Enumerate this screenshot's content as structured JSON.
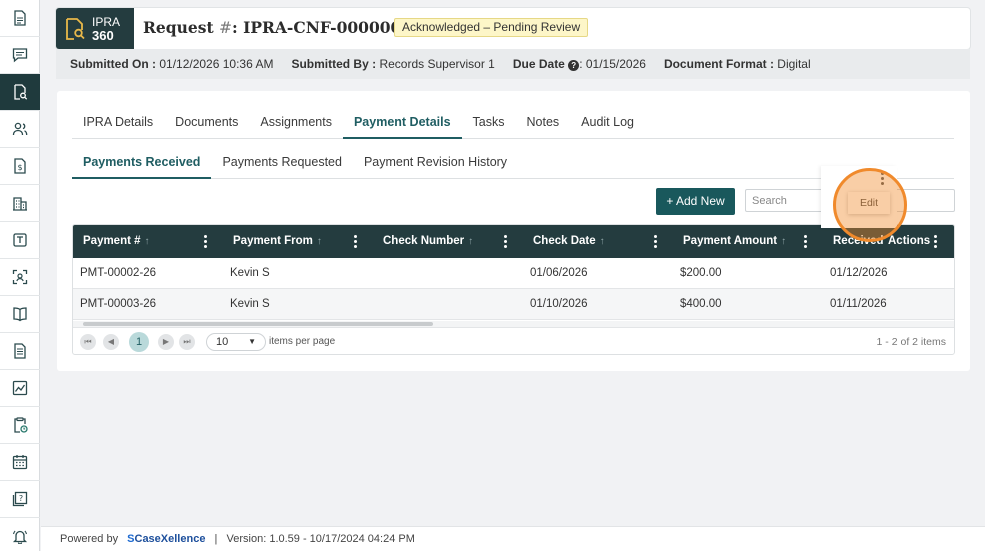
{
  "rail": {
    "items": [
      {
        "icon": "document-icon"
      },
      {
        "icon": "chat-icon"
      },
      {
        "icon": "document-search-icon",
        "active": true
      },
      {
        "icon": "users-icon"
      },
      {
        "icon": "invoice-icon"
      },
      {
        "icon": "building-icon"
      },
      {
        "icon": "template-icon"
      },
      {
        "icon": "scan-user-icon"
      },
      {
        "icon": "book-icon"
      },
      {
        "icon": "report-icon"
      },
      {
        "icon": "chart-icon"
      },
      {
        "icon": "clipboard-clock-icon"
      },
      {
        "icon": "calendar-icon"
      },
      {
        "icon": "help-doc-icon"
      },
      {
        "icon": "bell-icon"
      }
    ]
  },
  "header": {
    "logo_line1": "IPRA",
    "logo_line2": "360",
    "title_prefix": "Request ",
    "title_hash": "#",
    "title_id": ": IPRA-CNF-0000009-26",
    "status": "Acknowledged – Pending Review"
  },
  "meta": {
    "submitted_on_label": "Submitted On :",
    "submitted_on": "01/12/2026 10:36 AM",
    "submitted_by_label": "Submitted By :",
    "submitted_by": "Records Supervisor 1",
    "due_date_label": "Due Date",
    "due_date": ": 01/15/2026",
    "format_label": "Document Format :",
    "format": "Digital"
  },
  "tabs": [
    "IPRA Details",
    "Documents",
    "Assignments",
    "Payment Details",
    "Tasks",
    "Notes",
    "Audit Log"
  ],
  "active_tab": "Payment Details",
  "subtabs": [
    "Payments Received",
    "Payments Requested",
    "Payment Revision History"
  ],
  "toolbar": {
    "add_label": "+ Add New",
    "search_placeholder": "Search"
  },
  "grid": {
    "columns": [
      "Payment #",
      "Payment From",
      "Check Number",
      "Check Date",
      "Payment Amount",
      "Received",
      "Actions"
    ],
    "rows": [
      {
        "payment_no": "PMT-00002-26",
        "from": "Kevin S",
        "check_no": "",
        "check_date": "01/06/2026",
        "amount": "$200.00",
        "received": "01/12/2026"
      },
      {
        "payment_no": "PMT-00003-26",
        "from": "Kevin S",
        "check_no": "",
        "check_date": "01/10/2026",
        "amount": "$400.00",
        "received": "01/11/2026"
      }
    ],
    "action_menu": "Edit",
    "pager": {
      "page": "1",
      "page_size": "10",
      "per_page_label": "items per page",
      "info": "1 - 2 of 2 items"
    }
  },
  "footer": {
    "powered_by": "Powered by",
    "brand": "CaseXellence",
    "version": "|   Version: 1.0.59 - 10/17/2024 04:24 PM"
  },
  "colors": {
    "brand_dark": "#243c3f",
    "accent": "#19585c",
    "highlight": "#f08a2c",
    "status_bg": "#fdf6c8"
  }
}
